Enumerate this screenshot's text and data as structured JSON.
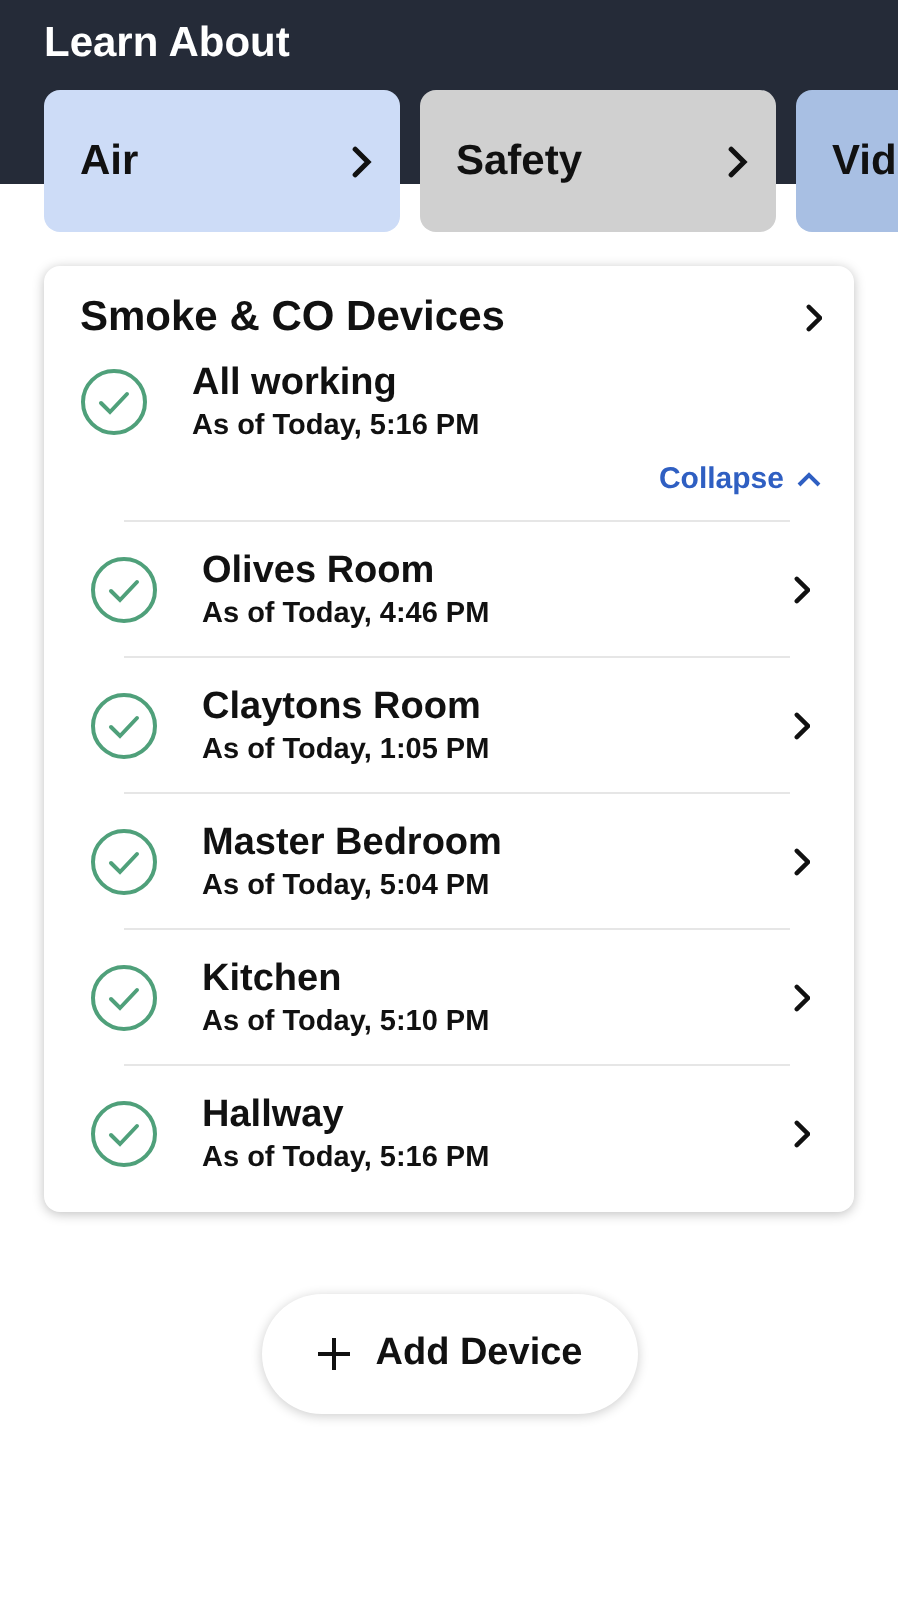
{
  "header": {
    "title": "Learn About"
  },
  "tabs": [
    {
      "label": "Air",
      "color": "#cddcf7"
    },
    {
      "label": "Safety",
      "color": "#d0d0d0"
    },
    {
      "label": "Vid",
      "color": "#a8bfe3"
    }
  ],
  "card": {
    "title": "Smoke & CO Devices",
    "summary": {
      "ok": true,
      "title": "All working",
      "time": "As of Today, 5:16 PM"
    },
    "toggle": {
      "label": "Collapse",
      "expanded": true
    },
    "devices": [
      {
        "name": "Olives Room",
        "time": "As of Today, 4:46 PM",
        "ok": true
      },
      {
        "name": "Claytons Room",
        "time": "As of Today, 1:05 PM",
        "ok": true
      },
      {
        "name": "Master Bedroom",
        "time": "As of Today, 5:04 PM",
        "ok": true
      },
      {
        "name": "Kitchen",
        "time": "As of Today, 5:10 PM",
        "ok": true
      },
      {
        "name": "Hallway",
        "time": "As of Today, 5:16 PM",
        "ok": true
      }
    ]
  },
  "add_button": {
    "label": "Add Device"
  }
}
